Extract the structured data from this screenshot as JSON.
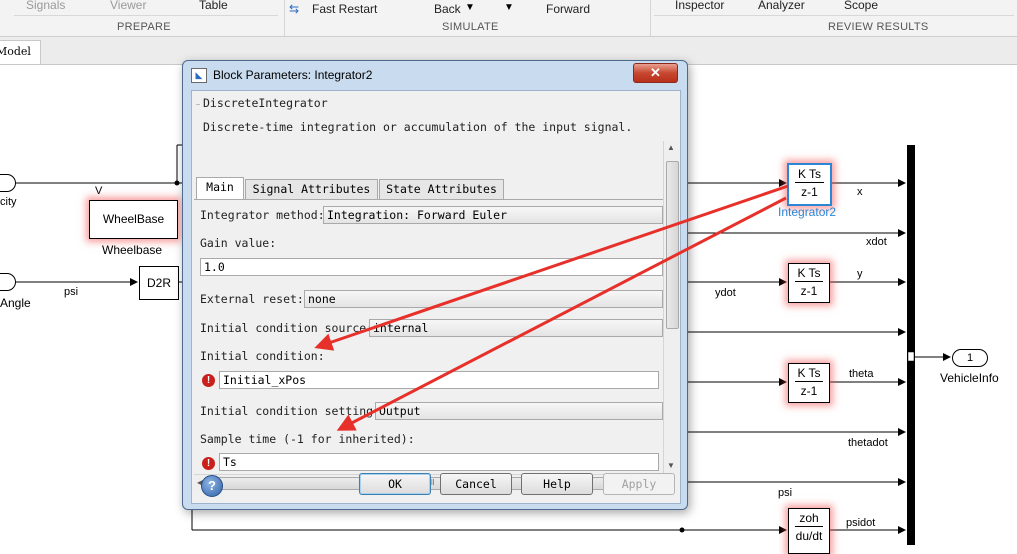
{
  "ribbon": {
    "prepare": {
      "items": [
        "Signals",
        "Viewer",
        "Table"
      ],
      "label": "PREPARE"
    },
    "simulate": {
      "fast_restart": "Fast Restart",
      "back": "Back",
      "forward": "Forward",
      "label": "SIMULATE"
    },
    "review": {
      "items": [
        "Inspector",
        "Analyzer",
        "Scope"
      ],
      "label": "REVIEW RESULTS"
    }
  },
  "model_tab": "Model",
  "diagram": {
    "ports_in": [
      {
        "label": "city"
      },
      {
        "label": "Angle"
      }
    ],
    "blocks": {
      "wheelbase": {
        "text": "WheelBase",
        "caption": "Wheelbase"
      },
      "d2r": {
        "text": "D2R"
      },
      "integrator2": {
        "num": "K Ts",
        "den": "z-1",
        "caption": "Integrator2"
      },
      "integrator_y": {
        "num": "K Ts",
        "den": "z-1"
      },
      "integrator_theta": {
        "num": "K Ts",
        "den": "z-1"
      },
      "derivative": {
        "num": "zoh",
        "den": "du/dt"
      }
    },
    "signals": {
      "v": "V",
      "psi_in": "psi",
      "x": "x",
      "xdot": "xdot",
      "y": "y",
      "ydot": "ydot",
      "theta": "theta",
      "thetadot": "thetadot",
      "psi": "psi",
      "psidot": "psidot"
    },
    "outport": {
      "number": "1",
      "label": "VehicleInfo"
    }
  },
  "dialog": {
    "title": "Block Parameters: Integrator2",
    "close": "✕",
    "block_type": "DiscreteIntegrator",
    "description": "Discrete-time integration or accumulation of the input signal.",
    "tabs": [
      {
        "label": "Main"
      },
      {
        "label": "Signal Attributes"
      },
      {
        "label": "State Attributes"
      }
    ],
    "params": {
      "method_label": "Integrator method:",
      "method_value": "Integration: Forward Euler",
      "gain_label": "Gain value:",
      "gain_value": "1.0",
      "reset_label": "External reset:",
      "reset_value": "none",
      "ic_source_label": "Initial condition source:",
      "ic_source_value": "internal",
      "ic_label": "Initial condition:",
      "ic_value": "Initial_xPos",
      "ic_setting_label": "Initial condition setting:",
      "ic_setting_value": "Output",
      "sample_label": "Sample time (-1 for inherited):",
      "sample_value": "Ts"
    },
    "buttons": {
      "help_icon": "?",
      "ok": "OK",
      "cancel": "Cancel",
      "help": "Help",
      "apply": "Apply"
    },
    "error_glyph": "!",
    "hscroll_grip": "III"
  },
  "colors": {
    "annotation_arrow": "#e8302a",
    "block_glow": "#f05050",
    "selected_block": "#2b86d6"
  }
}
